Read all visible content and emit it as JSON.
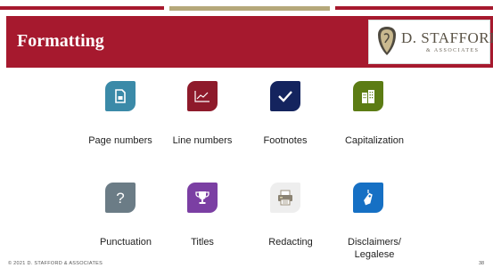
{
  "slide": {
    "title": "Formatting",
    "logo": {
      "name": "D. STAFFORD",
      "subtitle": "& ASSOCIATES"
    },
    "footer": {
      "copyright": "© 2021 D. STAFFORD & ASSOCIATES",
      "page_number": "38"
    }
  },
  "colors": {
    "banner": "#a6192e",
    "accent_bar": "#b5a87a"
  },
  "items": [
    {
      "label": "Page numbers",
      "icon": "document-icon",
      "color": "#3b8aa8"
    },
    {
      "label": "Line numbers",
      "icon": "line-chart-icon",
      "color": "#8e1a2b"
    },
    {
      "label": "Footnotes",
      "icon": "checkmark-icon",
      "color": "#14245e"
    },
    {
      "label": "Capitalization",
      "icon": "buildings-icon",
      "color": "#5c7c14"
    },
    {
      "label": "Punctuation",
      "icon": "question-mark-icon",
      "color": "#6b7c86"
    },
    {
      "label": "Titles",
      "icon": "trophy-icon",
      "color": "#7b3fa3"
    },
    {
      "label": "Redacting",
      "icon": "printer-icon",
      "color": "#eeeeee"
    },
    {
      "label": "Disclaimers/ Legalese",
      "icon": "tag-icon",
      "color": "#1670c4"
    }
  ]
}
